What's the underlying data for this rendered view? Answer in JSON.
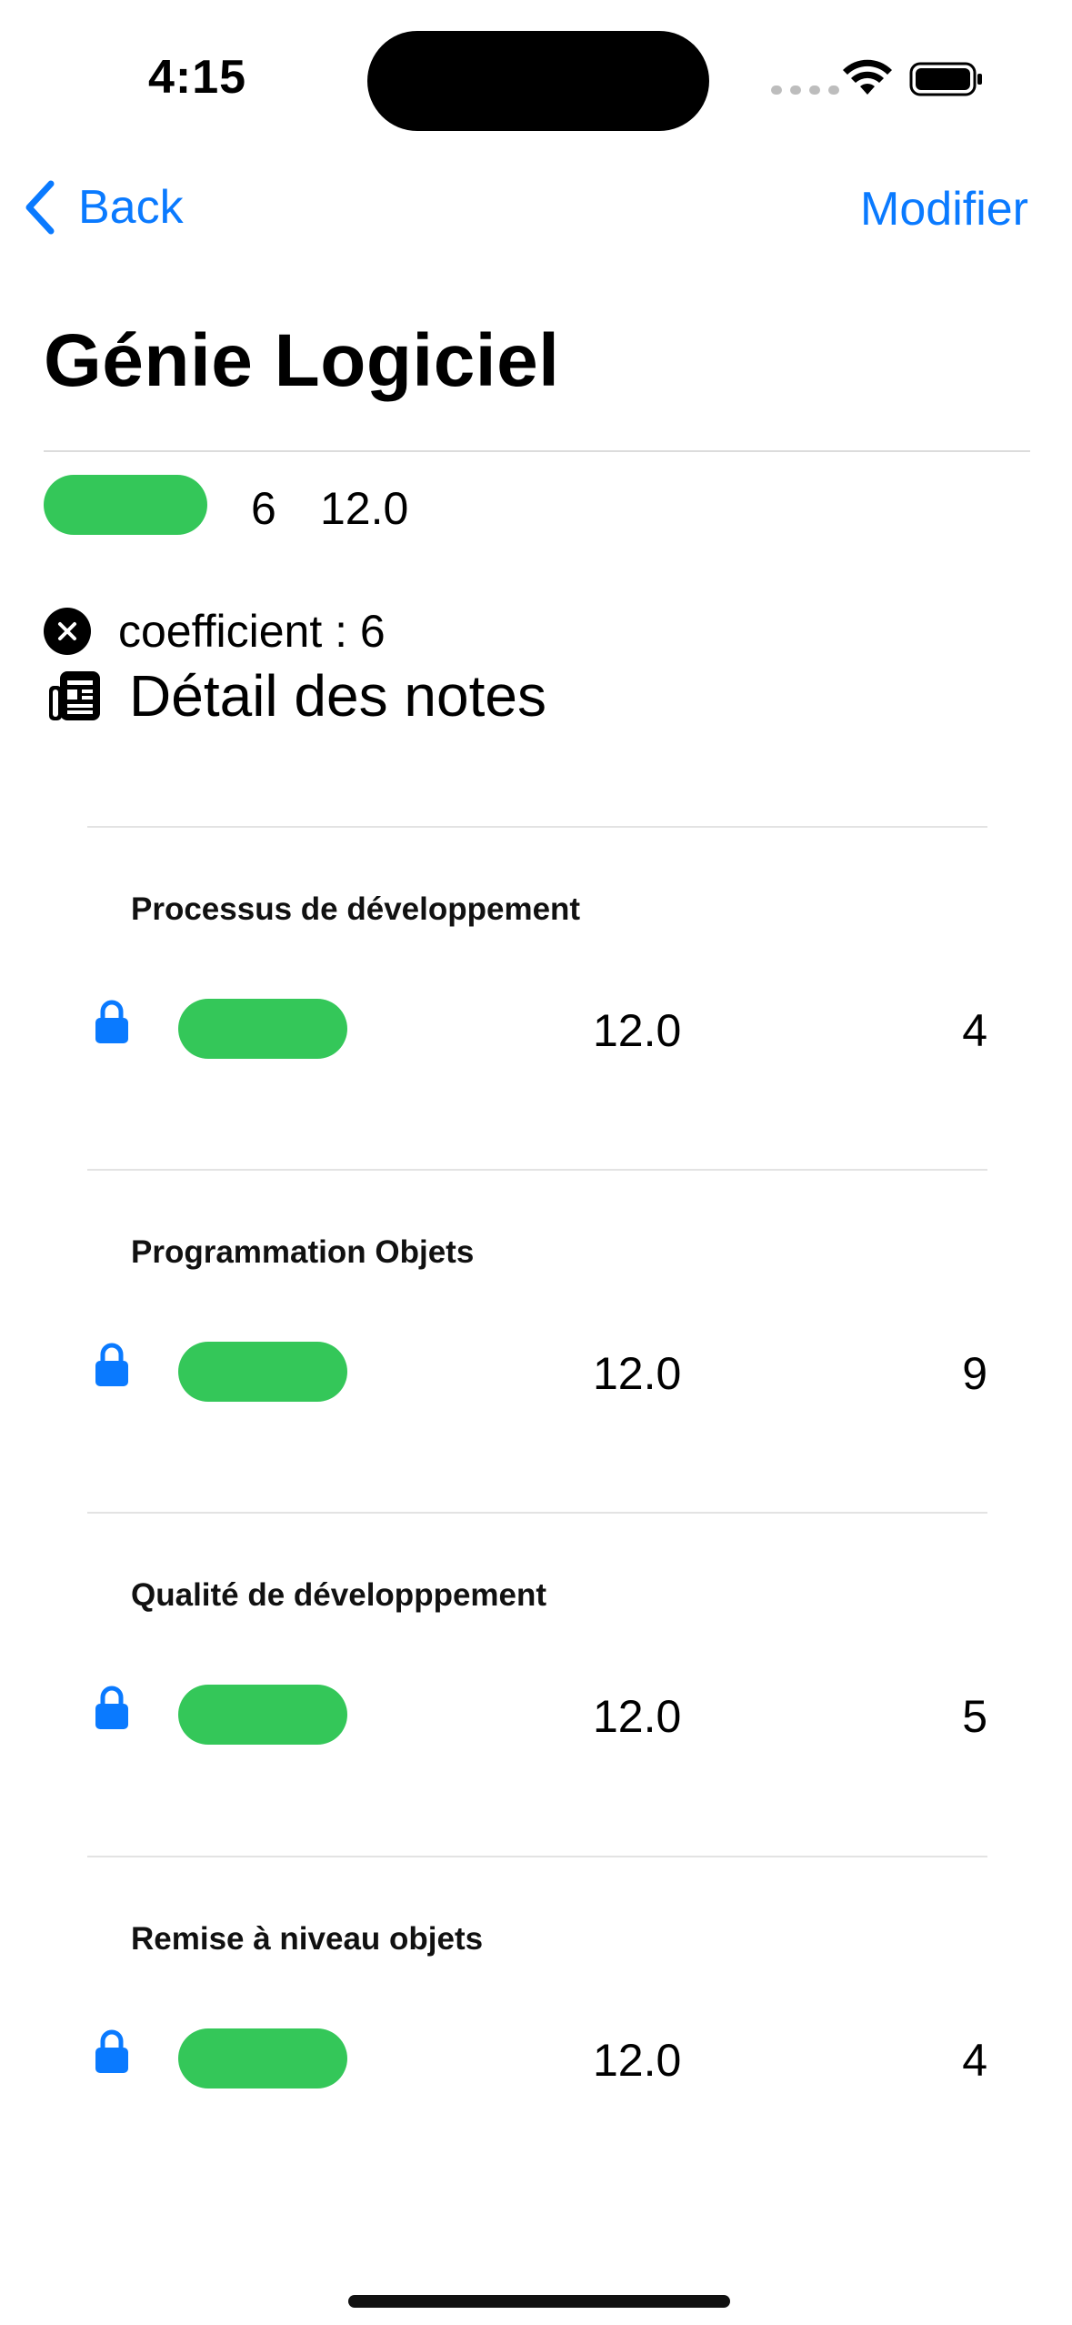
{
  "status_bar": {
    "time": "4:15"
  },
  "nav": {
    "back_label": "Back",
    "edit_label": "Modifier"
  },
  "page": {
    "title": "Génie Logiciel"
  },
  "summary": {
    "coefficient": "6",
    "average": "12.0",
    "indicator_color": "#34c759"
  },
  "coefficient_label": "coefficient : 6",
  "detail_title": "Détail des notes",
  "modules": [
    {
      "name": "Processus de développement",
      "grade": "12.0",
      "coefficient": "4"
    },
    {
      "name": "Programmation Objets",
      "grade": "12.0",
      "coefficient": "9"
    },
    {
      "name": "Qualité de développpement",
      "grade": "12.0",
      "coefficient": "5"
    },
    {
      "name": "Remise à niveau objets",
      "grade": "12.0",
      "coefficient": "4"
    }
  ],
  "colors": {
    "accent": "#0a7aff",
    "success": "#34c759"
  },
  "icons": [
    "chevron-left-icon",
    "close-circle-icon",
    "newspaper-icon",
    "lock-icon",
    "wifi-icon",
    "battery-icon"
  ]
}
